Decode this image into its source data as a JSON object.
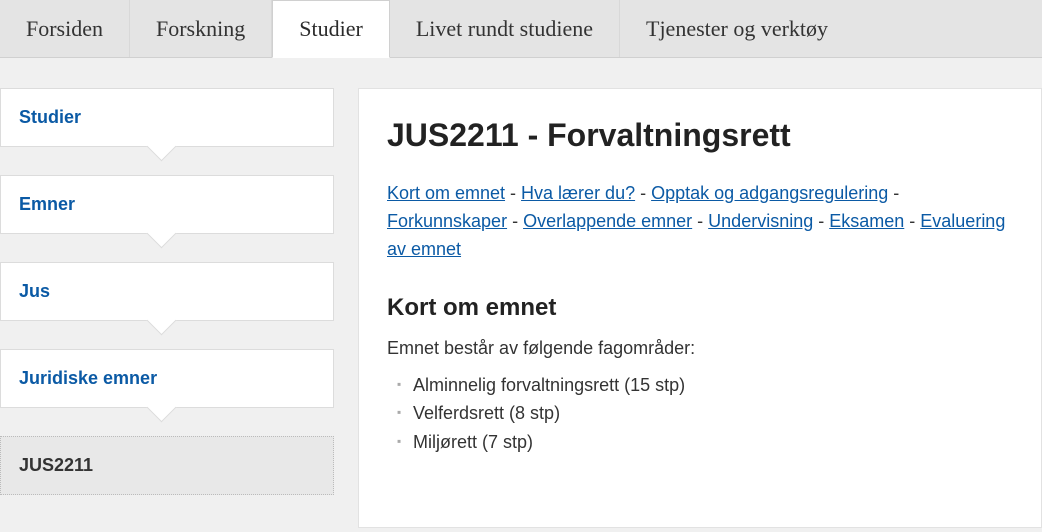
{
  "topnav": {
    "tabs": [
      {
        "label": "Forsiden"
      },
      {
        "label": "Forskning"
      },
      {
        "label": "Studier"
      },
      {
        "label": "Livet rundt studiene"
      },
      {
        "label": "Tjenester og verktøy"
      }
    ],
    "active_index": 2
  },
  "sidebar": {
    "crumbs": [
      {
        "label": "Studier"
      },
      {
        "label": "Emner"
      },
      {
        "label": "Jus"
      },
      {
        "label": "Juridiske emner"
      },
      {
        "label": "JUS2211"
      }
    ],
    "current_index": 4
  },
  "main": {
    "title": "JUS2211 - Forvaltningsrett",
    "anchors": [
      "Kort om emnet",
      "Hva lærer du?",
      "Opptak og adgangsregulering",
      "Forkunnskaper",
      "Overlappende emner",
      "Undervisning",
      "Eksamen",
      "Evaluering av emnet"
    ],
    "anchor_separator": " - ",
    "section_heading": "Kort om emnet",
    "intro_text": "Emnet består av følgende fagområder:",
    "bullets": [
      "Alminnelig forvaltningsrett (15 stp)",
      "Velferdsrett (8 stp)",
      "Miljørett (7 stp)"
    ]
  }
}
